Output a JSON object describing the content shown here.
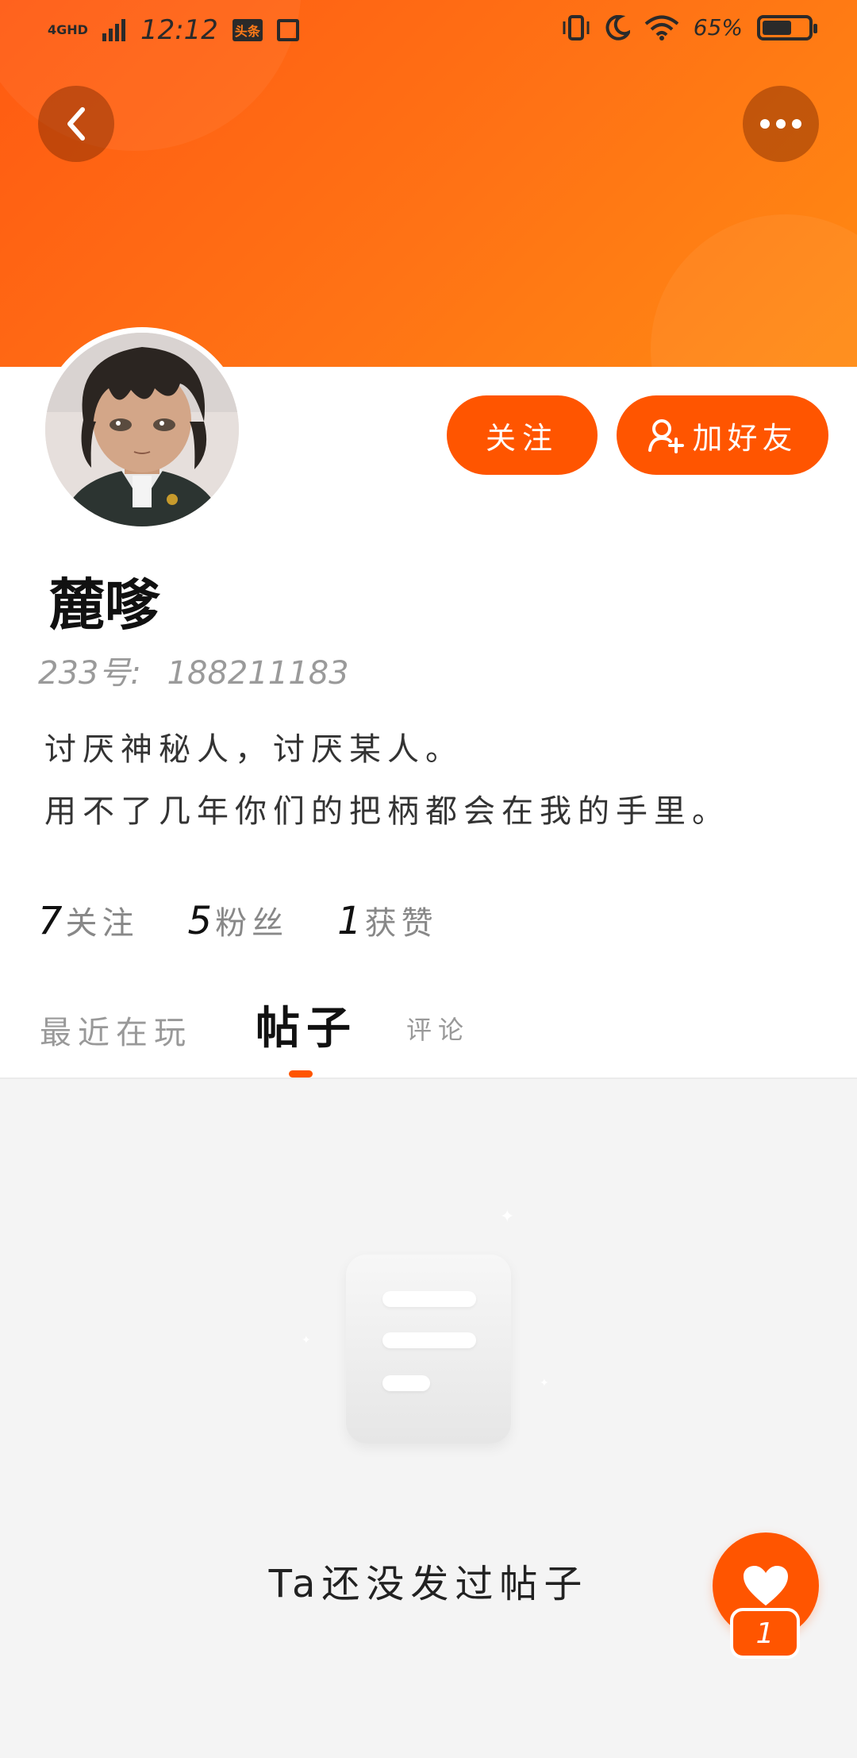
{
  "status_bar": {
    "network": "4GHD",
    "time": "12:12",
    "app_badge": "头条",
    "battery": "65%",
    "battery_level": 0.65
  },
  "header": {
    "back_icon": "chevron-left-icon",
    "more_icon": "more-dots-icon"
  },
  "profile": {
    "name": "麓嗲",
    "id_label": "233号:",
    "id_value": "188211183",
    "bio_lines": [
      "讨厌神秘人，讨厌某人。",
      "用不了几年你们的把柄都会在我的手里。"
    ],
    "follow_button": "关注",
    "add_friend_button": "加好友",
    "add_friend_icon": "add-user-icon"
  },
  "stats": {
    "following_count": "7",
    "following_label": "关注",
    "fans_count": "5",
    "fans_label": "粉丝",
    "likes_count": "1",
    "likes_label": "获赞"
  },
  "tabs": {
    "recent": "最近在玩",
    "posts": "帖子",
    "comments": "评论",
    "active": "posts"
  },
  "empty_state": {
    "message": "Ta还没发过帖子",
    "icon": "empty-document-icon"
  },
  "like_fab": {
    "icon": "heart-icon",
    "count": "1"
  },
  "colors": {
    "accent": "#ff5500",
    "banner_start": "#ff5a12",
    "banner_end": "#ff8a12"
  }
}
